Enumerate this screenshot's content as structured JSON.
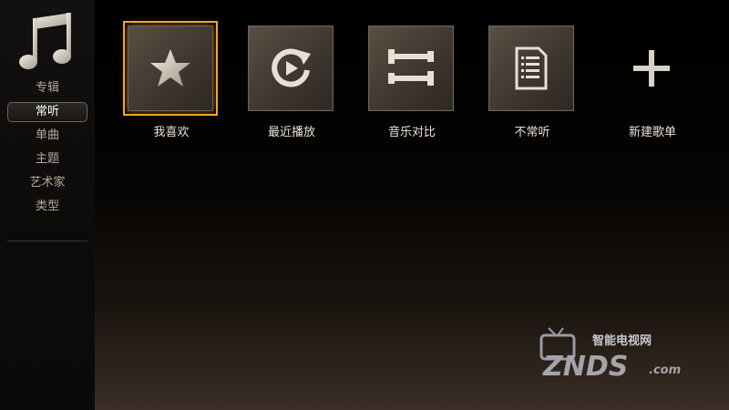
{
  "sidebar": {
    "logo_icon": "music-note-icon",
    "items": [
      {
        "label": "专辑",
        "active": false
      },
      {
        "label": "常听",
        "active": true
      },
      {
        "label": "单曲",
        "active": false
      },
      {
        "label": "主题",
        "active": false
      },
      {
        "label": "艺术家",
        "active": false
      },
      {
        "label": "类型",
        "active": false
      }
    ]
  },
  "tiles": [
    {
      "label": "我喜欢",
      "icon": "star-icon",
      "focused": true
    },
    {
      "label": "最近播放",
      "icon": "replay-icon",
      "focused": false
    },
    {
      "label": "音乐对比",
      "icon": "compare-icon",
      "focused": false
    },
    {
      "label": "不常听",
      "icon": "document-list-icon",
      "focused": false
    },
    {
      "label": "新建歌单",
      "icon": "plus-icon",
      "focused": false
    }
  ],
  "watermark": {
    "top_text": "智能电视网",
    "brand": "ZNDS",
    "suffix": ".com"
  },
  "colors": {
    "focus": "#f0a52c",
    "tile": "#4a4038",
    "text": "#e8e2d8",
    "nav_text": "#b6aa98"
  }
}
